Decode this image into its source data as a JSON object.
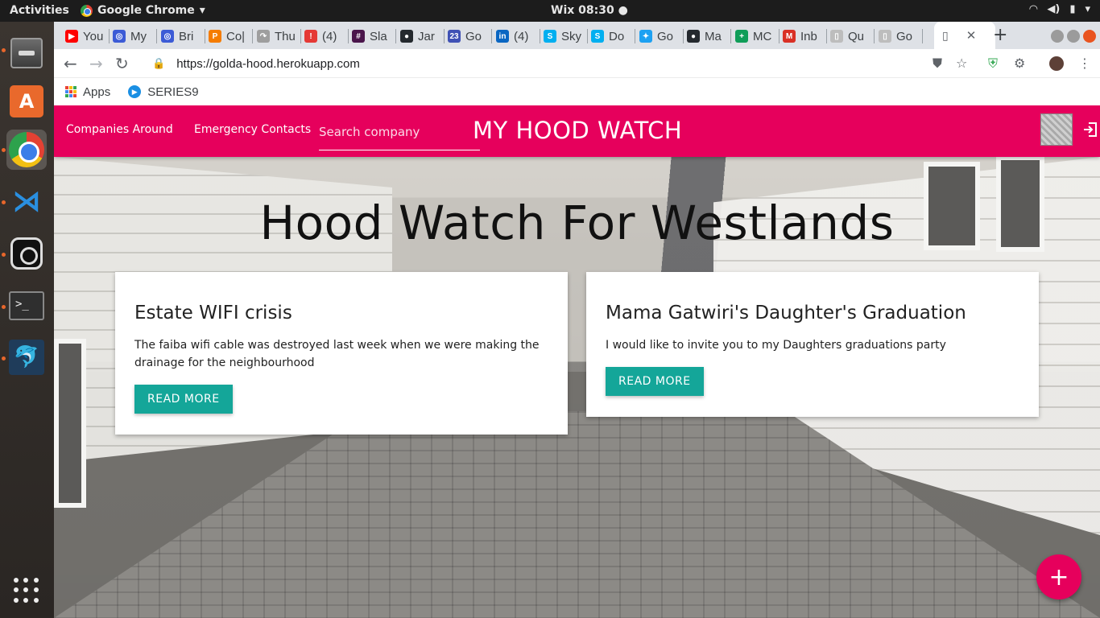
{
  "os": {
    "activities": "Activities",
    "app_name": "Google Chrome",
    "clock": "Wix 08:30 ●"
  },
  "browser": {
    "tabs": [
      {
        "label": "You",
        "color": "#ff0000",
        "glyph": "▶"
      },
      {
        "label": "My",
        "color": "#3c5bd6",
        "glyph": "◎"
      },
      {
        "label": "Bri",
        "color": "#3c5bd6",
        "glyph": "◎"
      },
      {
        "label": "Co|",
        "color": "#f57c00",
        "glyph": "P"
      },
      {
        "label": "Thu",
        "color": "#9e9e9e",
        "glyph": "↷"
      },
      {
        "label": "(4)",
        "color": "#e53935",
        "glyph": "!"
      },
      {
        "label": "Sla",
        "color": "#4a154b",
        "glyph": "#"
      },
      {
        "label": "Jar",
        "color": "#24292e",
        "glyph": "●"
      },
      {
        "label": "Go",
        "color": "#3f51b5",
        "glyph": "23"
      },
      {
        "label": "(4)",
        "color": "#0a66c2",
        "glyph": "in"
      },
      {
        "label": "Sky",
        "color": "#00aff0",
        "glyph": "S"
      },
      {
        "label": "Do",
        "color": "#00aff0",
        "glyph": "S"
      },
      {
        "label": "Go",
        "color": "#1da1f2",
        "glyph": "✦"
      },
      {
        "label": "Ma",
        "color": "#24292e",
        "glyph": "●"
      },
      {
        "label": "MC",
        "color": "#0f9d58",
        "glyph": "+"
      },
      {
        "label": "Inb",
        "color": "#d93025",
        "glyph": "M"
      },
      {
        "label": "Qu",
        "color": "#bdbdbd",
        "glyph": "▯"
      },
      {
        "label": "Go",
        "color": "#bdbdbd",
        "glyph": "▯"
      }
    ],
    "url": "https://golda-hood.herokuapp.com",
    "bookmarks": {
      "apps": "Apps",
      "series9": "SERIES9"
    }
  },
  "site": {
    "nav": {
      "companies": "Companies Around",
      "emergency": "Emergency Contacts",
      "search_placeholder": "Search company",
      "brand": "MY HOOD WATCH"
    },
    "hero_title": "Hood Watch For Westlands",
    "posts": [
      {
        "title": "Estate WIFI crisis",
        "body": "The faiba wifi cable was destroyed last week when we were making the drainage for the neighbourhood",
        "button": "READ MORE"
      },
      {
        "title": "Mama Gatwiri's Daughter's Graduation",
        "body": "I would like to invite you to my Daughters graduations party",
        "button": "READ MORE"
      }
    ],
    "fab": "+"
  },
  "colors": {
    "primary": "#e6005c",
    "accent": "#14a699"
  }
}
